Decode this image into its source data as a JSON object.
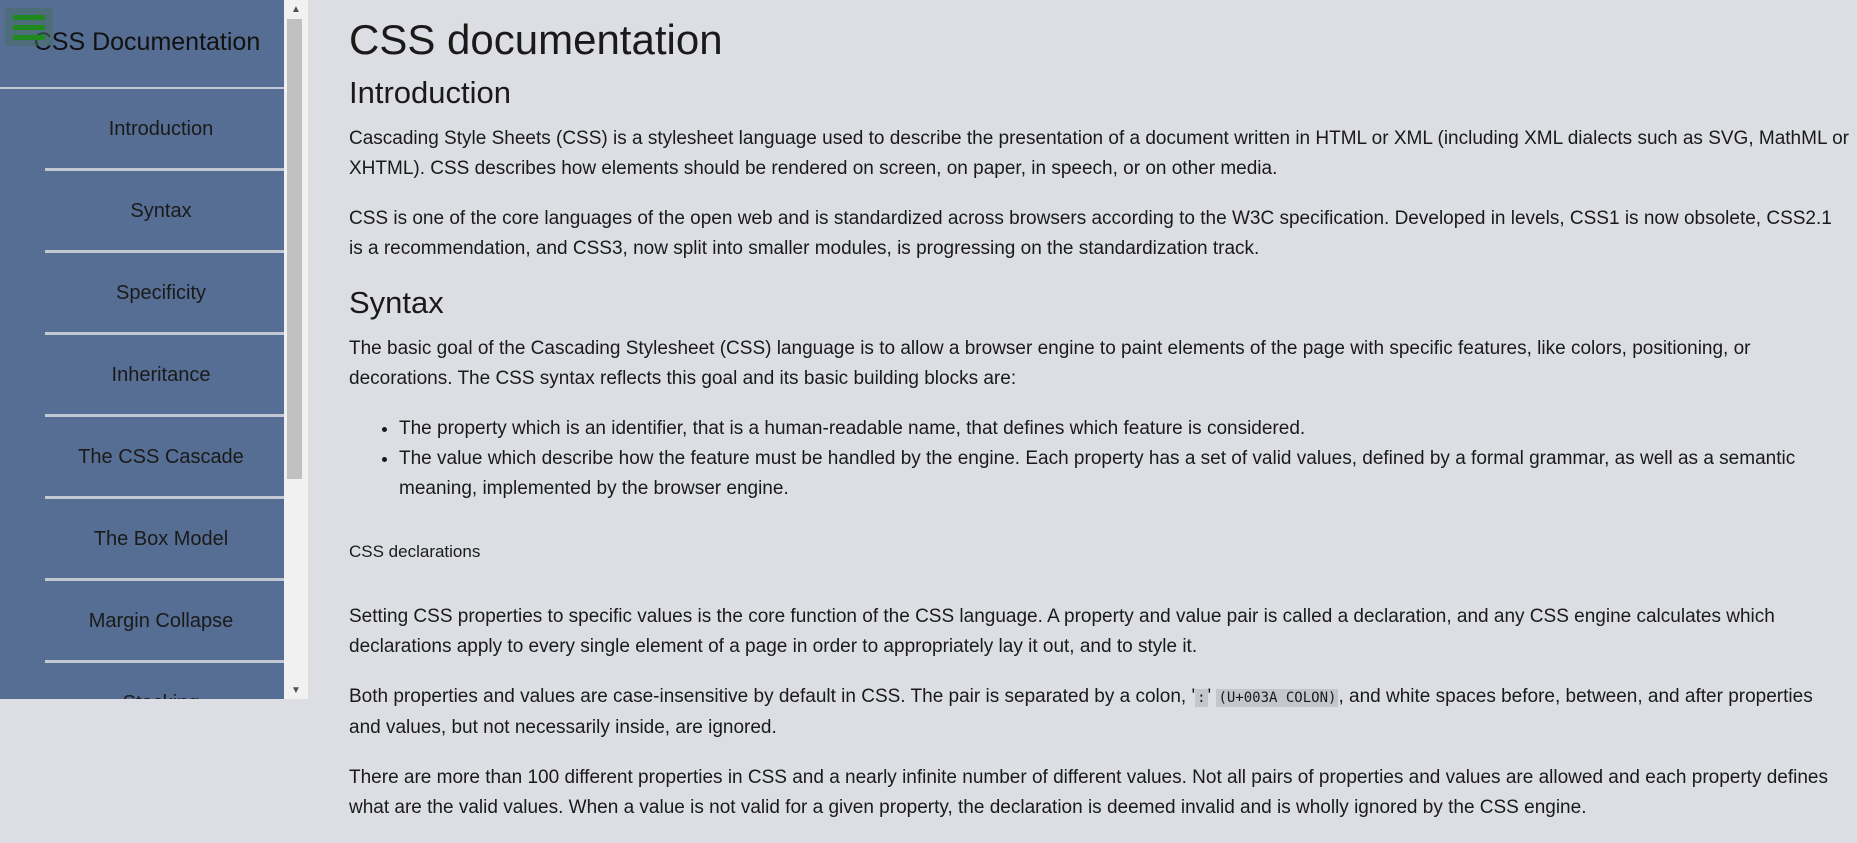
{
  "sidebar": {
    "title": "CSS Documentation",
    "items": [
      {
        "label": "Introduction"
      },
      {
        "label": "Syntax"
      },
      {
        "label": "Specificity"
      },
      {
        "label": "Inheritance"
      },
      {
        "label": "The CSS Cascade"
      },
      {
        "label": "The Box Model"
      },
      {
        "label": "Margin Collapse"
      },
      {
        "label": "Stacking"
      }
    ]
  },
  "main": {
    "title": "CSS documentation",
    "intro": {
      "heading": "Introduction",
      "p1": "Cascading Style Sheets (CSS) is a stylesheet language used to describe the presentation of a document written in HTML or XML (including XML dialects such as SVG, MathML or XHTML). CSS describes how elements should be rendered on screen, on paper, in speech, or on other media.",
      "p2": "CSS is one of the core languages of the open web and is standardized across browsers according to the W3C specification. Developed in levels, CSS1 is now obsolete, CSS2.1 is a recommendation, and CSS3, now split into smaller modules, is progressing on the standardization track."
    },
    "syntax": {
      "heading": "Syntax",
      "p1": "The basic goal of the Cascading Stylesheet (CSS) language is to allow a browser engine to paint elements of the page with specific features, like colors, positioning, or decorations. The CSS syntax reflects this goal and its basic building blocks are:",
      "bullets": [
        "The property which is an identifier, that is a human-readable name, that defines which feature is considered.",
        "The value which describe how the feature must be handled by the engine. Each property has a set of valid values, defined by a formal grammar, as well as a semantic meaning, implemented by the browser engine."
      ],
      "subheading": "CSS declarations",
      "p2": "Setting CSS properties to specific values is the core function of the CSS language. A property and value pair is called a declaration, and any CSS engine calculates which declarations apply to every single element of a page in order to appropriately lay it out, and to style it.",
      "p3_before": "Both properties and values are case-insensitive by default in CSS. The pair is separated by a colon, '",
      "p3_code1": ":",
      "p3_mid": "' ",
      "p3_code2": "(U+003A COLON)",
      "p3_after": ", and white spaces before, between, and after properties and values, but not necessarily inside, are ignored.",
      "p4": "There are more than 100 different properties in CSS and a nearly infinite number of different values. Not all pairs of properties and values are allowed and each property defines what are the valid values. When a value is not valid for a given property, the declaration is deemed invalid and is wholly ignored by the CSS engine."
    }
  },
  "scrollbar": {
    "up": "▲",
    "down": "▼"
  },
  "colors": {
    "sidebar_bg": "#566e93",
    "page_bg": "#dcdee3",
    "menu_icon": "#1e8a1e"
  }
}
